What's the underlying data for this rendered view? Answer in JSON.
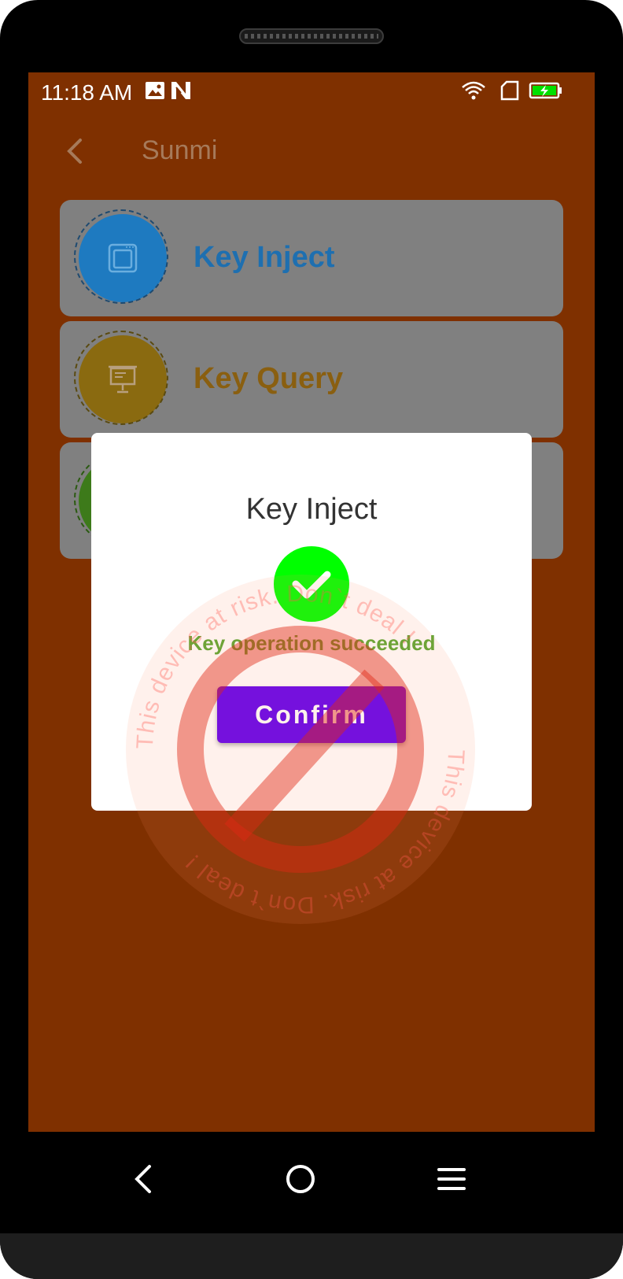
{
  "status_bar": {
    "time": "11:18 AM",
    "left_icons": [
      "image-icon",
      "n-notification-icon"
    ],
    "right_icons": [
      "wifi-icon",
      "sim-card-icon",
      "battery-charging-icon"
    ]
  },
  "app_bar": {
    "back_icon": "chevron-left-icon",
    "title": "Sunmi"
  },
  "menu": {
    "items": [
      {
        "label": "Key Inject",
        "icon": "card-reader-icon",
        "circle_color": "#1e7ac0",
        "label_color": "#1e6fb0"
      },
      {
        "label": "Key Query",
        "icon": "presentation-board-icon",
        "circle_color": "#8a6a10",
        "label_color": "#8a5f10"
      },
      {
        "label": "",
        "icon": "",
        "circle_color": "#3d7a1a",
        "label_color": "#3d7a1a"
      }
    ]
  },
  "dialog": {
    "title": "Key Inject",
    "status_icon": "check-circle-icon",
    "message": "Key operation succeeded",
    "confirm_label": "Confirm"
  },
  "watermark": {
    "text": "This device at risk. Don`t deal !",
    "icon": "prohibited-icon"
  },
  "nav_bar": {
    "buttons": [
      "back-nav-icon",
      "home-nav-icon",
      "menu-nav-icon"
    ]
  },
  "colors": {
    "screen_bg": "#7f3000",
    "card_bg": "#808080",
    "accent": "#6200ee",
    "success_green": "#00ff00",
    "message_green": "#5aa732"
  }
}
